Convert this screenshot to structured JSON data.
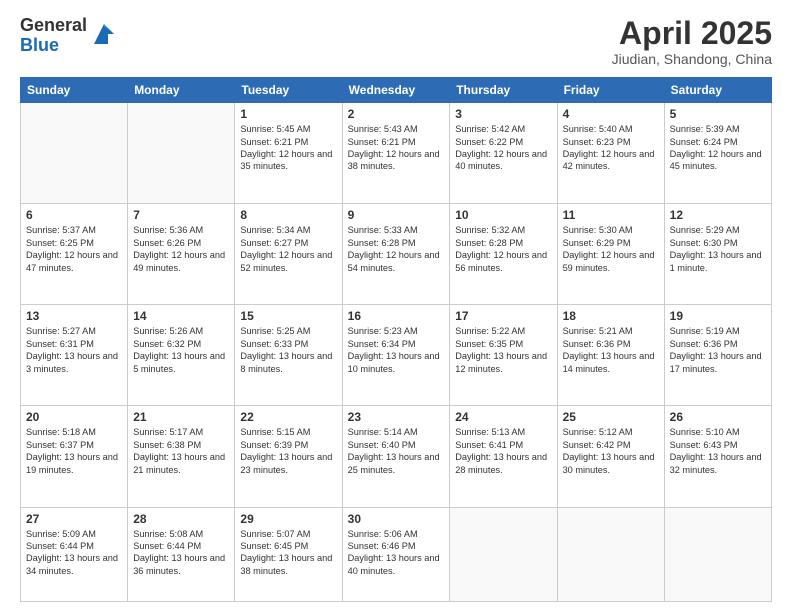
{
  "logo": {
    "general": "General",
    "blue": "Blue"
  },
  "title": "April 2025",
  "location": "Jiudian, Shandong, China",
  "weekdays": [
    "Sunday",
    "Monday",
    "Tuesday",
    "Wednesday",
    "Thursday",
    "Friday",
    "Saturday"
  ],
  "weeks": [
    [
      {
        "day": "",
        "sunrise": "",
        "sunset": "",
        "daylight": ""
      },
      {
        "day": "",
        "sunrise": "",
        "sunset": "",
        "daylight": ""
      },
      {
        "day": "1",
        "sunrise": "Sunrise: 5:45 AM",
        "sunset": "Sunset: 6:21 PM",
        "daylight": "Daylight: 12 hours and 35 minutes."
      },
      {
        "day": "2",
        "sunrise": "Sunrise: 5:43 AM",
        "sunset": "Sunset: 6:21 PM",
        "daylight": "Daylight: 12 hours and 38 minutes."
      },
      {
        "day": "3",
        "sunrise": "Sunrise: 5:42 AM",
        "sunset": "Sunset: 6:22 PM",
        "daylight": "Daylight: 12 hours and 40 minutes."
      },
      {
        "day": "4",
        "sunrise": "Sunrise: 5:40 AM",
        "sunset": "Sunset: 6:23 PM",
        "daylight": "Daylight: 12 hours and 42 minutes."
      },
      {
        "day": "5",
        "sunrise": "Sunrise: 5:39 AM",
        "sunset": "Sunset: 6:24 PM",
        "daylight": "Daylight: 12 hours and 45 minutes."
      }
    ],
    [
      {
        "day": "6",
        "sunrise": "Sunrise: 5:37 AM",
        "sunset": "Sunset: 6:25 PM",
        "daylight": "Daylight: 12 hours and 47 minutes."
      },
      {
        "day": "7",
        "sunrise": "Sunrise: 5:36 AM",
        "sunset": "Sunset: 6:26 PM",
        "daylight": "Daylight: 12 hours and 49 minutes."
      },
      {
        "day": "8",
        "sunrise": "Sunrise: 5:34 AM",
        "sunset": "Sunset: 6:27 PM",
        "daylight": "Daylight: 12 hours and 52 minutes."
      },
      {
        "day": "9",
        "sunrise": "Sunrise: 5:33 AM",
        "sunset": "Sunset: 6:28 PM",
        "daylight": "Daylight: 12 hours and 54 minutes."
      },
      {
        "day": "10",
        "sunrise": "Sunrise: 5:32 AM",
        "sunset": "Sunset: 6:28 PM",
        "daylight": "Daylight: 12 hours and 56 minutes."
      },
      {
        "day": "11",
        "sunrise": "Sunrise: 5:30 AM",
        "sunset": "Sunset: 6:29 PM",
        "daylight": "Daylight: 12 hours and 59 minutes."
      },
      {
        "day": "12",
        "sunrise": "Sunrise: 5:29 AM",
        "sunset": "Sunset: 6:30 PM",
        "daylight": "Daylight: 13 hours and 1 minute."
      }
    ],
    [
      {
        "day": "13",
        "sunrise": "Sunrise: 5:27 AM",
        "sunset": "Sunset: 6:31 PM",
        "daylight": "Daylight: 13 hours and 3 minutes."
      },
      {
        "day": "14",
        "sunrise": "Sunrise: 5:26 AM",
        "sunset": "Sunset: 6:32 PM",
        "daylight": "Daylight: 13 hours and 5 minutes."
      },
      {
        "day": "15",
        "sunrise": "Sunrise: 5:25 AM",
        "sunset": "Sunset: 6:33 PM",
        "daylight": "Daylight: 13 hours and 8 minutes."
      },
      {
        "day": "16",
        "sunrise": "Sunrise: 5:23 AM",
        "sunset": "Sunset: 6:34 PM",
        "daylight": "Daylight: 13 hours and 10 minutes."
      },
      {
        "day": "17",
        "sunrise": "Sunrise: 5:22 AM",
        "sunset": "Sunset: 6:35 PM",
        "daylight": "Daylight: 13 hours and 12 minutes."
      },
      {
        "day": "18",
        "sunrise": "Sunrise: 5:21 AM",
        "sunset": "Sunset: 6:36 PM",
        "daylight": "Daylight: 13 hours and 14 minutes."
      },
      {
        "day": "19",
        "sunrise": "Sunrise: 5:19 AM",
        "sunset": "Sunset: 6:36 PM",
        "daylight": "Daylight: 13 hours and 17 minutes."
      }
    ],
    [
      {
        "day": "20",
        "sunrise": "Sunrise: 5:18 AM",
        "sunset": "Sunset: 6:37 PM",
        "daylight": "Daylight: 13 hours and 19 minutes."
      },
      {
        "day": "21",
        "sunrise": "Sunrise: 5:17 AM",
        "sunset": "Sunset: 6:38 PM",
        "daylight": "Daylight: 13 hours and 21 minutes."
      },
      {
        "day": "22",
        "sunrise": "Sunrise: 5:15 AM",
        "sunset": "Sunset: 6:39 PM",
        "daylight": "Daylight: 13 hours and 23 minutes."
      },
      {
        "day": "23",
        "sunrise": "Sunrise: 5:14 AM",
        "sunset": "Sunset: 6:40 PM",
        "daylight": "Daylight: 13 hours and 25 minutes."
      },
      {
        "day": "24",
        "sunrise": "Sunrise: 5:13 AM",
        "sunset": "Sunset: 6:41 PM",
        "daylight": "Daylight: 13 hours and 28 minutes."
      },
      {
        "day": "25",
        "sunrise": "Sunrise: 5:12 AM",
        "sunset": "Sunset: 6:42 PM",
        "daylight": "Daylight: 13 hours and 30 minutes."
      },
      {
        "day": "26",
        "sunrise": "Sunrise: 5:10 AM",
        "sunset": "Sunset: 6:43 PM",
        "daylight": "Daylight: 13 hours and 32 minutes."
      }
    ],
    [
      {
        "day": "27",
        "sunrise": "Sunrise: 5:09 AM",
        "sunset": "Sunset: 6:44 PM",
        "daylight": "Daylight: 13 hours and 34 minutes."
      },
      {
        "day": "28",
        "sunrise": "Sunrise: 5:08 AM",
        "sunset": "Sunset: 6:44 PM",
        "daylight": "Daylight: 13 hours and 36 minutes."
      },
      {
        "day": "29",
        "sunrise": "Sunrise: 5:07 AM",
        "sunset": "Sunset: 6:45 PM",
        "daylight": "Daylight: 13 hours and 38 minutes."
      },
      {
        "day": "30",
        "sunrise": "Sunrise: 5:06 AM",
        "sunset": "Sunset: 6:46 PM",
        "daylight": "Daylight: 13 hours and 40 minutes."
      },
      {
        "day": "",
        "sunrise": "",
        "sunset": "",
        "daylight": ""
      },
      {
        "day": "",
        "sunrise": "",
        "sunset": "",
        "daylight": ""
      },
      {
        "day": "",
        "sunrise": "",
        "sunset": "",
        "daylight": ""
      }
    ]
  ]
}
